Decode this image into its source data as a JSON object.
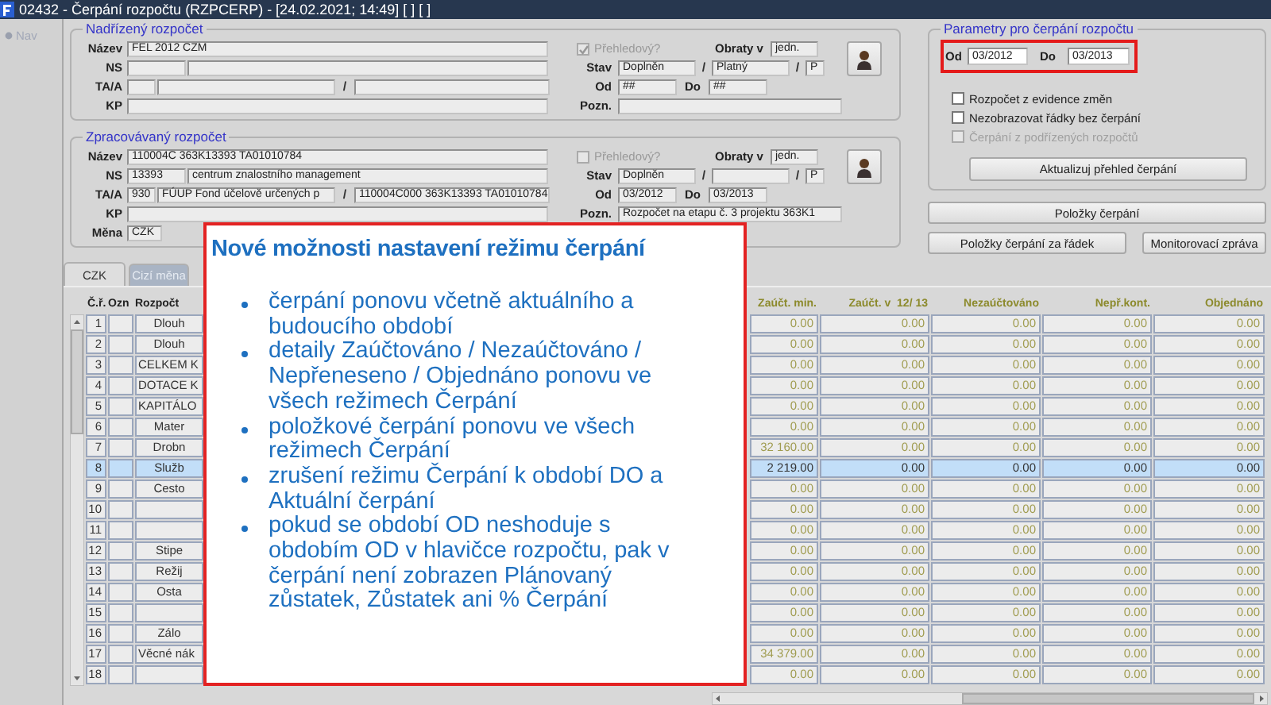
{
  "window": {
    "title": "02432 - Čerpání rozpočtu (RZPCERP) - [24.02.2021; 14:49] [ ] [ ]"
  },
  "nav": {
    "label": "Nav"
  },
  "superior_budget": {
    "legend": "Nadřízený rozpočet",
    "rows": [
      {
        "label": "Název",
        "kind": "single",
        "values": [
          "FEL 2012 CZM"
        ]
      },
      {
        "label": "NS",
        "kind": "pair"
      },
      {
        "label": "TA/A",
        "kind": "triple",
        "separator": "/"
      },
      {
        "label": "KP",
        "kind": "single"
      }
    ],
    "overview": {
      "label": "Přehledový?",
      "checked": true,
      "disabled": true
    },
    "turnover": {
      "label": "Obraty v",
      "value": "jedn."
    },
    "status": {
      "label": "Stav",
      "state": "Doplněn",
      "validity": "Platný",
      "type": "P",
      "separator": "/"
    },
    "period": {
      "label": "Od",
      "from": "##",
      "to_label": "Do",
      "to": "##"
    },
    "note": {
      "label": "Pozn."
    }
  },
  "processed_budget": {
    "legend": "Zpracovávaný rozpočet",
    "rows": [
      {
        "label": "Název",
        "kind": "single",
        "values": [
          "110004C 363K13393 TA01010784"
        ]
      },
      {
        "label": "NS",
        "kind": "pair",
        "values": [
          "13393",
          "centrum znalostního management"
        ]
      },
      {
        "label": "TA/A",
        "kind": "triple",
        "separator": "/",
        "values": [
          "930",
          "FÚUP Fond účelově určených p",
          "110004C000 363K13393 TA01010784"
        ]
      },
      {
        "label": "KP",
        "kind": "single"
      },
      {
        "label": "Měna",
        "kind": "short",
        "values": [
          "CZK"
        ]
      }
    ],
    "overview": {
      "label": "Přehledový?",
      "checked": false,
      "disabled": true
    },
    "turnover": {
      "label": "Obraty v",
      "value": "jedn."
    },
    "status": {
      "label": "Stav",
      "state": "Doplněn",
      "type": "P",
      "separator": "/"
    },
    "period": {
      "label": "Od",
      "from": "03/2012",
      "to_label": "Do",
      "to": "03/2013"
    },
    "note": {
      "label": "Pozn.",
      "value": "Rozpočet na etapu č. 3 projektu 363K1"
    }
  },
  "params": {
    "legend": "Parametry pro čerpání rozpočtu",
    "from_label": "Od",
    "from": "03/2012",
    "to_label": "Do",
    "to": "03/2013",
    "highlighted": true,
    "options": [
      {
        "label": "Rozpočet z evidence změn",
        "checked": false,
        "disabled": false
      },
      {
        "label": "Nezobrazovat řádky bez čerpání",
        "checked": false,
        "disabled": false
      },
      {
        "label": "Čerpání z podřízených rozpočtů",
        "checked": false,
        "disabled": true
      }
    ],
    "button": "Aktualizuj přehled čerpání"
  },
  "actions": [
    "Položky čerpání",
    "Položky čerpání za řádek",
    "Monitorovací zpráva"
  ],
  "tabs": [
    {
      "label": "CZK",
      "selected": true,
      "disabled": false
    },
    {
      "label": "Cizí měna",
      "selected": false,
      "disabled": true
    }
  ],
  "table": {
    "columns": [
      {
        "label": "Č.ř.",
        "kind": "number"
      },
      {
        "label": "Ozn",
        "kind": "mark"
      },
      {
        "label": "Rozpočt",
        "kind": "name"
      },
      {
        "label": "Zaúčt. min.",
        "kind": "amount"
      },
      {
        "label": "Zaúčt. v  12/ 13",
        "kind": "amount"
      },
      {
        "label": "Nezaúčtováno",
        "kind": "amount"
      },
      {
        "label": "Nepř.kont.",
        "kind": "amount"
      },
      {
        "label": "Objednáno",
        "kind": "amount"
      }
    ],
    "rows": [
      {
        "no": "1",
        "name": "Dlouh",
        "kind": "item",
        "selected": false,
        "amounts": [
          "0.00",
          "0.00",
          "0.00",
          "0.00",
          "0.00"
        ]
      },
      {
        "no": "2",
        "name": "Dlouh",
        "kind": "item",
        "selected": false,
        "amounts": [
          "0.00",
          "0.00",
          "0.00",
          "0.00",
          "0.00"
        ]
      },
      {
        "no": "3",
        "name": "CELKEM K",
        "kind": "group",
        "selected": false,
        "amounts": [
          "0.00",
          "0.00",
          "0.00",
          "0.00",
          "0.00"
        ]
      },
      {
        "no": "4",
        "name": "DOTACE K",
        "kind": "group",
        "selected": false,
        "amounts": [
          "0.00",
          "0.00",
          "0.00",
          "0.00",
          "0.00"
        ]
      },
      {
        "no": "5",
        "name": "KAPITÁLO",
        "kind": "group",
        "selected": false,
        "amounts": [
          "0.00",
          "0.00",
          "0.00",
          "0.00",
          "0.00"
        ]
      },
      {
        "no": "6",
        "name": "Mater",
        "kind": "item",
        "selected": false,
        "amounts": [
          "0.00",
          "0.00",
          "0.00",
          "0.00",
          "0.00"
        ]
      },
      {
        "no": "7",
        "name": "Drobn",
        "kind": "item",
        "selected": false,
        "amounts": [
          "32 160.00",
          "0.00",
          "0.00",
          "0.00",
          "0.00"
        ]
      },
      {
        "no": "8",
        "name": "Služb",
        "kind": "item",
        "selected": true,
        "amounts": [
          "2 219.00",
          "0.00",
          "0.00",
          "0.00",
          "0.00"
        ]
      },
      {
        "no": "9",
        "name": "Cesto",
        "kind": "item",
        "selected": false,
        "amounts": [
          "0.00",
          "0.00",
          "0.00",
          "0.00",
          "0.00"
        ]
      },
      {
        "no": "10",
        "kind": "item",
        "selected": false,
        "amounts": [
          "0.00",
          "0.00",
          "0.00",
          "0.00",
          "0.00"
        ]
      },
      {
        "no": "11",
        "kind": "item",
        "selected": false,
        "amounts": [
          "0.00",
          "0.00",
          "0.00",
          "0.00",
          "0.00"
        ]
      },
      {
        "no": "12",
        "name": "Stipe",
        "kind": "item",
        "selected": false,
        "amounts": [
          "0.00",
          "0.00",
          "0.00",
          "0.00",
          "0.00"
        ]
      },
      {
        "no": "13",
        "name": "Režij",
        "kind": "item",
        "selected": false,
        "amounts": [
          "0.00",
          "0.00",
          "0.00",
          "0.00",
          "0.00"
        ]
      },
      {
        "no": "14",
        "name": "Osta",
        "kind": "item",
        "selected": false,
        "amounts": [
          "0.00",
          "0.00",
          "0.00",
          "0.00",
          "0.00"
        ]
      },
      {
        "no": "15",
        "kind": "item",
        "selected": false,
        "amounts": [
          "0.00",
          "0.00",
          "0.00",
          "0.00",
          "0.00"
        ]
      },
      {
        "no": "16",
        "name": "Zálo",
        "kind": "item",
        "selected": false,
        "amounts": [
          "0.00",
          "0.00",
          "0.00",
          "0.00",
          "0.00"
        ]
      },
      {
        "no": "17",
        "name": "Věcné nák",
        "kind": "group",
        "selected": false,
        "amounts": [
          "34 379.00",
          "0.00",
          "0.00",
          "0.00",
          "0.00"
        ]
      },
      {
        "no": "18",
        "kind": "item",
        "selected": false,
        "amounts": [
          "0.00",
          "0.00",
          "0.00",
          "0.00",
          "0.00"
        ]
      }
    ]
  },
  "callout": {
    "title": "Nové možnosti nastavení režimu čerpání",
    "bullets": [
      "čerpání ponovu včetně aktuálního a budoucího období",
      "detaily Zaúčtováno / Nezaúčtováno / Nepřeneseno / Objednáno ponovu ve všech režimech Čerpání",
      "položkové čerpání ponovu ve všech režimech Čerpání",
      "zrušení režimu Čerpání k období DO a Aktuální čerpání",
      "pokud se období OD neshoduje s obdobím OD v hlavičce rozpočtu, pak v čerpání není zobrazen Plánovaný zůstatek, Zůstatek ani % Čerpání"
    ]
  }
}
